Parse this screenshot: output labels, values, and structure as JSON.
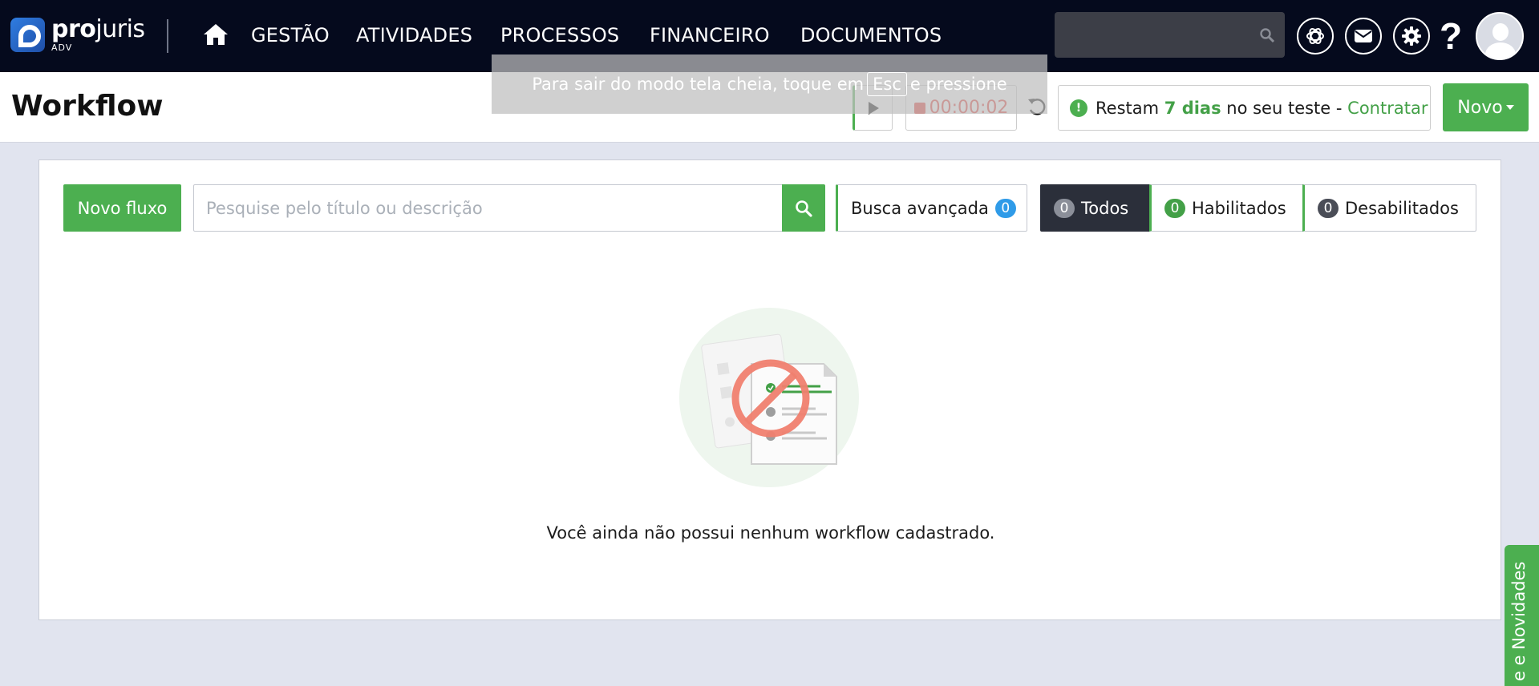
{
  "app": {
    "logo_text_light": "pro",
    "logo_text_regular": "juris",
    "logo_sub": "ADV"
  },
  "nav": {
    "items": [
      "GESTÃO",
      "ATIVIDADES",
      "PROCESSOS",
      "FINANCEIRO",
      "DOCUMENTOS"
    ],
    "help_glyph": "?"
  },
  "header": {
    "title": "Workflow",
    "fullscreen_notice_before": "Para sair do modo tela cheia, toque em",
    "fullscreen_notice_key": "Esc",
    "fullscreen_notice_after": "e pressione",
    "timer": "00:00:02",
    "trial_prefix": "Restam",
    "trial_days": "7 dias",
    "trial_middle": "no seu teste -",
    "trial_link": "Contratar",
    "new_button": "Novo"
  },
  "toolbar": {
    "new_flow_button": "Novo fluxo",
    "search_placeholder": "Pesquise pelo título ou descrição",
    "advanced_search": "Busca avançada",
    "advanced_search_count": "0",
    "filters": [
      {
        "label": "Todos",
        "count": "0"
      },
      {
        "label": "Habilitados",
        "count": "0"
      },
      {
        "label": "Desabilitados",
        "count": "0"
      }
    ]
  },
  "empty_state": {
    "message": "Você ainda não possui nenhum workflow cadastrado."
  },
  "side_tab": {
    "label": "e e Novidades"
  },
  "colors": {
    "topbar": "#050a1d",
    "accent_green": "#4caf50",
    "timer_red": "#e53935",
    "badge_blue": "#2f9be8",
    "active_filter": "#2b2f3a"
  }
}
